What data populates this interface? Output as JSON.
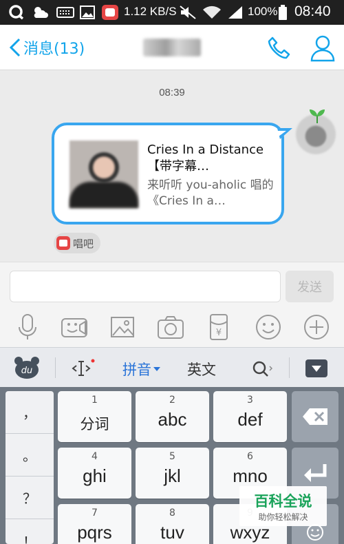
{
  "status_bar": {
    "speed": "1.12 KB/S",
    "battery": "100%",
    "time": "08:40"
  },
  "nav": {
    "back_label": "消息(13)"
  },
  "chat": {
    "timestamp": "08:39",
    "card": {
      "title": "Cries In a Distance【带字幕…",
      "description": "来听听 you-aholic 唱的《Cries In a…"
    },
    "source_label": "唱吧"
  },
  "composer": {
    "input_value": "",
    "send_label": "发送",
    "tools": [
      "microphone-icon",
      "video-icon",
      "image-icon",
      "camera-icon",
      "red-packet-icon",
      "emoji-icon",
      "plus-icon"
    ]
  },
  "keyboard": {
    "toolbar": {
      "pinyin": "拼音",
      "english": "英文"
    },
    "side_keys": [
      "，",
      "。",
      "？",
      "！"
    ],
    "keys": [
      {
        "num": "1",
        "label": "分词"
      },
      {
        "num": "2",
        "label": "abc"
      },
      {
        "num": "3",
        "label": "def"
      },
      {
        "num": "4",
        "label": "ghi"
      },
      {
        "num": "5",
        "label": "jkl"
      },
      {
        "num": "6",
        "label": "mno"
      },
      {
        "num": "7",
        "label": "pqrs"
      },
      {
        "num": "8",
        "label": "tuv"
      },
      {
        "num": "9",
        "label": "wxyz"
      }
    ]
  },
  "watermark": {
    "title": "百科全说",
    "subtitle": "助你轻松解决"
  },
  "colors": {
    "accent": "#12a4ea",
    "bubble_border": "#39a6ef",
    "keyboard_bg": "#6f7882",
    "watermark_green": "#1aa35a"
  }
}
